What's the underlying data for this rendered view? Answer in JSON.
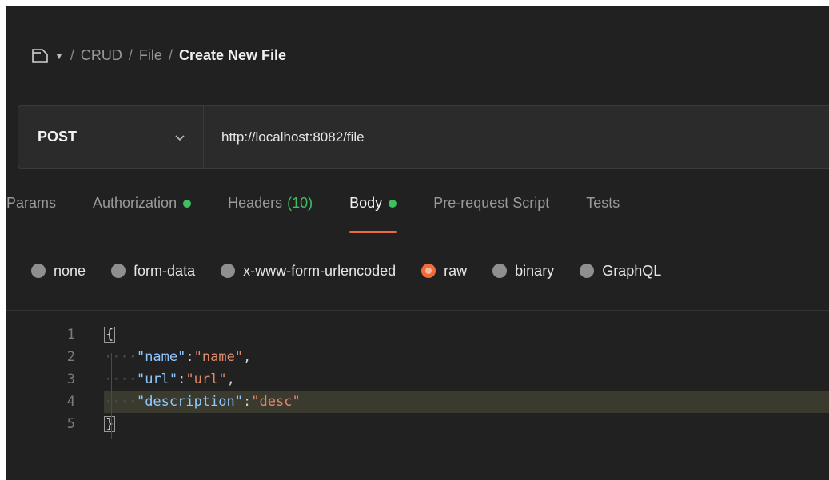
{
  "breadcrumb": {
    "items": [
      "CRUD",
      "File"
    ],
    "current": "Create New File",
    "separator": "/"
  },
  "request": {
    "method": "POST",
    "url": "http://localhost:8082/file"
  },
  "tabs": {
    "params": "Params",
    "authorization": "Authorization",
    "headers": "Headers",
    "headers_count": "(10)",
    "body": "Body",
    "prerequest": "Pre-request Script",
    "tests": "Tests"
  },
  "body_types": {
    "none": "none",
    "form_data": "form-data",
    "urlencoded": "x-www-form-urlencoded",
    "raw": "raw",
    "binary": "binary",
    "graphql": "GraphQL"
  },
  "editor": {
    "line_numbers": [
      "1",
      "2",
      "3",
      "4",
      "5"
    ],
    "open_brace": "{",
    "close_brace": "}",
    "lines": [
      {
        "key": "\"name\"",
        "colon": ":",
        "value": "\"name\"",
        "comma": ","
      },
      {
        "key": "\"url\"",
        "colon": ":",
        "value": "\"url\"",
        "comma": ","
      },
      {
        "key": "\"description\"",
        "colon": ":",
        "value": "\"desc\"",
        "comma": ""
      }
    ],
    "indent": "····"
  },
  "colors": {
    "accent": "#f26b3a",
    "status_green": "#3fbf5f",
    "background": "#212121"
  }
}
